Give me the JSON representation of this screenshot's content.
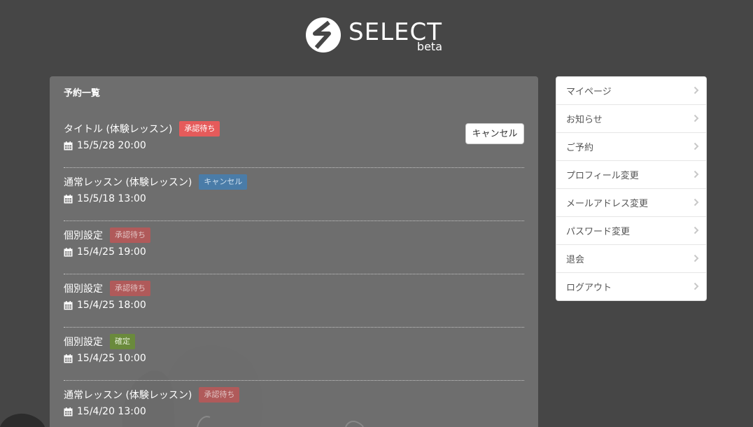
{
  "header": {
    "logo_name": "SELECT",
    "logo_suffix": "beta"
  },
  "panel": {
    "title": "予約一覧",
    "reservations": [
      {
        "title": "タイトル (体験レッスン)",
        "status": "承認待ち",
        "datetime": "15/5/28 20:00",
        "action_label": "キャンセル"
      },
      {
        "title": "通常レッスン (体験レッスン)",
        "status": "キャンセル",
        "datetime": "15/5/18 13:00"
      },
      {
        "title": "個別設定",
        "status": "承認待ち",
        "datetime": "15/4/25 19:00"
      },
      {
        "title": "個別設定",
        "status": "承認待ち",
        "datetime": "15/4/25 18:00"
      },
      {
        "title": "個別設定",
        "status": "確定",
        "datetime": "15/4/25 10:00"
      },
      {
        "title": "通常レッスン (体験レッスン)",
        "status": "承認待ち",
        "datetime": "15/4/20 13:00"
      }
    ]
  },
  "sidebar": {
    "items": [
      {
        "label": "マイページ"
      },
      {
        "label": "お知らせ"
      },
      {
        "label": "ご予約"
      },
      {
        "label": "プロフィール変更"
      },
      {
        "label": "メールアドレス変更"
      },
      {
        "label": "パスワード変更"
      },
      {
        "label": "退会"
      },
      {
        "label": "ログアウト"
      }
    ]
  },
  "colors": {
    "background": "#464646",
    "panel": "#787878",
    "badge_pending": "#e55b5b",
    "badge_cancel": "#4a7ca8",
    "badge_confirm": "#6a8a3c"
  },
  "icons": [
    "logo-mark-icon",
    "calendar-icon",
    "chevron-right-icon"
  ]
}
